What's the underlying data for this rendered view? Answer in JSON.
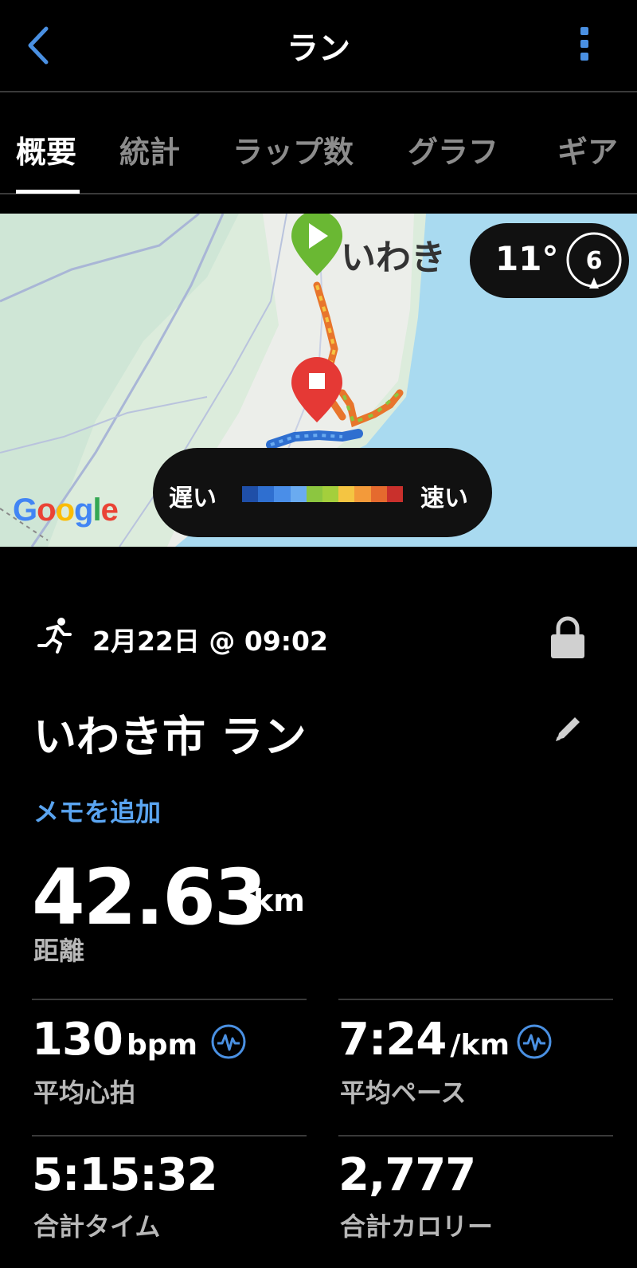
{
  "header": {
    "title": "ラン"
  },
  "tabs": [
    {
      "label": "概要",
      "active": true
    },
    {
      "label": "統計"
    },
    {
      "label": "ラップ数"
    },
    {
      "label": "グラフ"
    },
    {
      "label": "ギア"
    }
  ],
  "map": {
    "place_label": "いわき",
    "legend": {
      "slow": "遅い",
      "fast": "速い",
      "colors": [
        "#1f4fa8",
        "#2f6fd0",
        "#4a8ee8",
        "#6aabf0",
        "#8cc640",
        "#a4cf3c",
        "#f4c542",
        "#f39a3a",
        "#e56a2e",
        "#c9302c"
      ]
    },
    "weather": {
      "temp": "11°",
      "wind": "6"
    },
    "attribution": "Google"
  },
  "activity": {
    "datetime": "2月22日 @ 09:02",
    "title": "いわき市 ラン",
    "add_memo": "メモを追加",
    "distance": {
      "value": "42.63",
      "unit": "km",
      "label": "距離"
    },
    "stats": [
      {
        "value": "130",
        "unit": "bpm",
        "label": "平均心拍",
        "icon": "heart-rate-icon"
      },
      {
        "value": "7:24",
        "unit": "/km",
        "label": "平均ペース",
        "icon": "heart-rate-icon"
      },
      {
        "value": "5:15:32",
        "unit": "",
        "label": "合計タイム"
      },
      {
        "value": "2,777",
        "unit": "",
        "label": "合計カロリー"
      }
    ]
  }
}
